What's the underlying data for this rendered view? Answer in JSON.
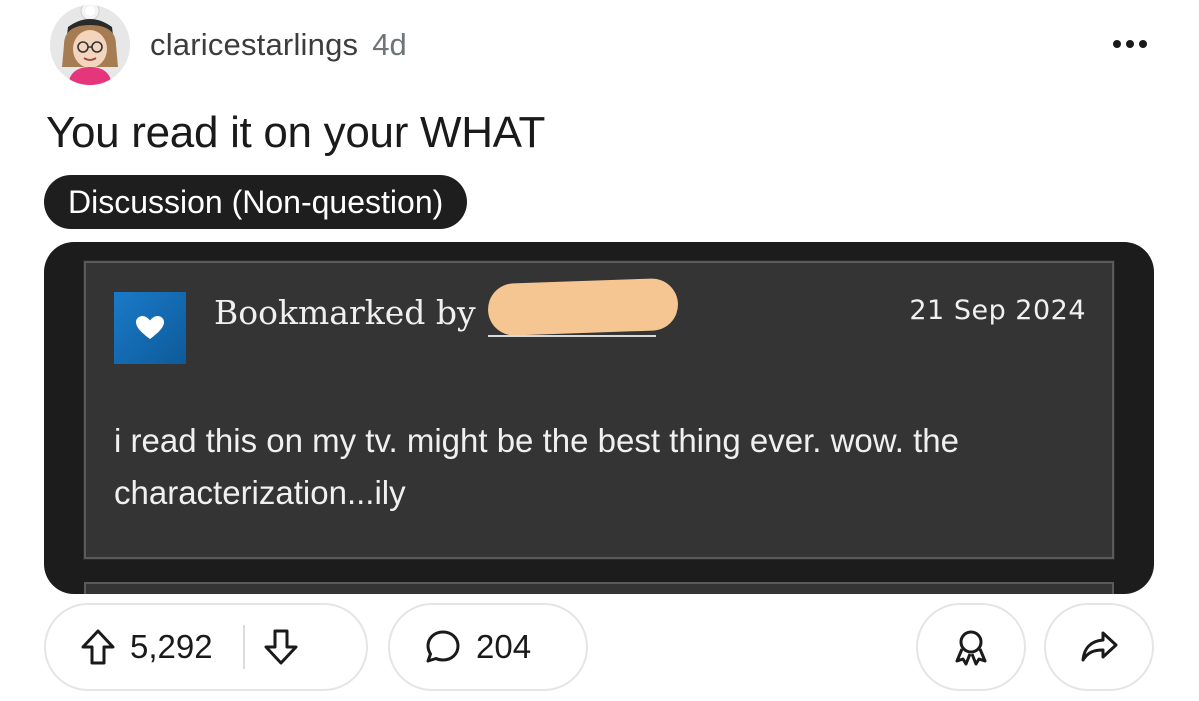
{
  "post": {
    "username": "claricestarlings",
    "age": "4d",
    "title": "You read it on your WHAT",
    "flair": "Discussion (Non-question)"
  },
  "embedded_card": {
    "bookmarked_label": "Bookmarked by",
    "date": "21 Sep 2024",
    "comment": "i read this on my tv. might be the best thing ever. wow. the characterization...ily"
  },
  "actions": {
    "upvotes": "5,292",
    "comments": "204"
  },
  "colors": {
    "flair_bg": "#1e1e1e",
    "card_bg": "#343434",
    "bookmark_icon": "#1a7ac8",
    "redaction": "#f5c592"
  }
}
